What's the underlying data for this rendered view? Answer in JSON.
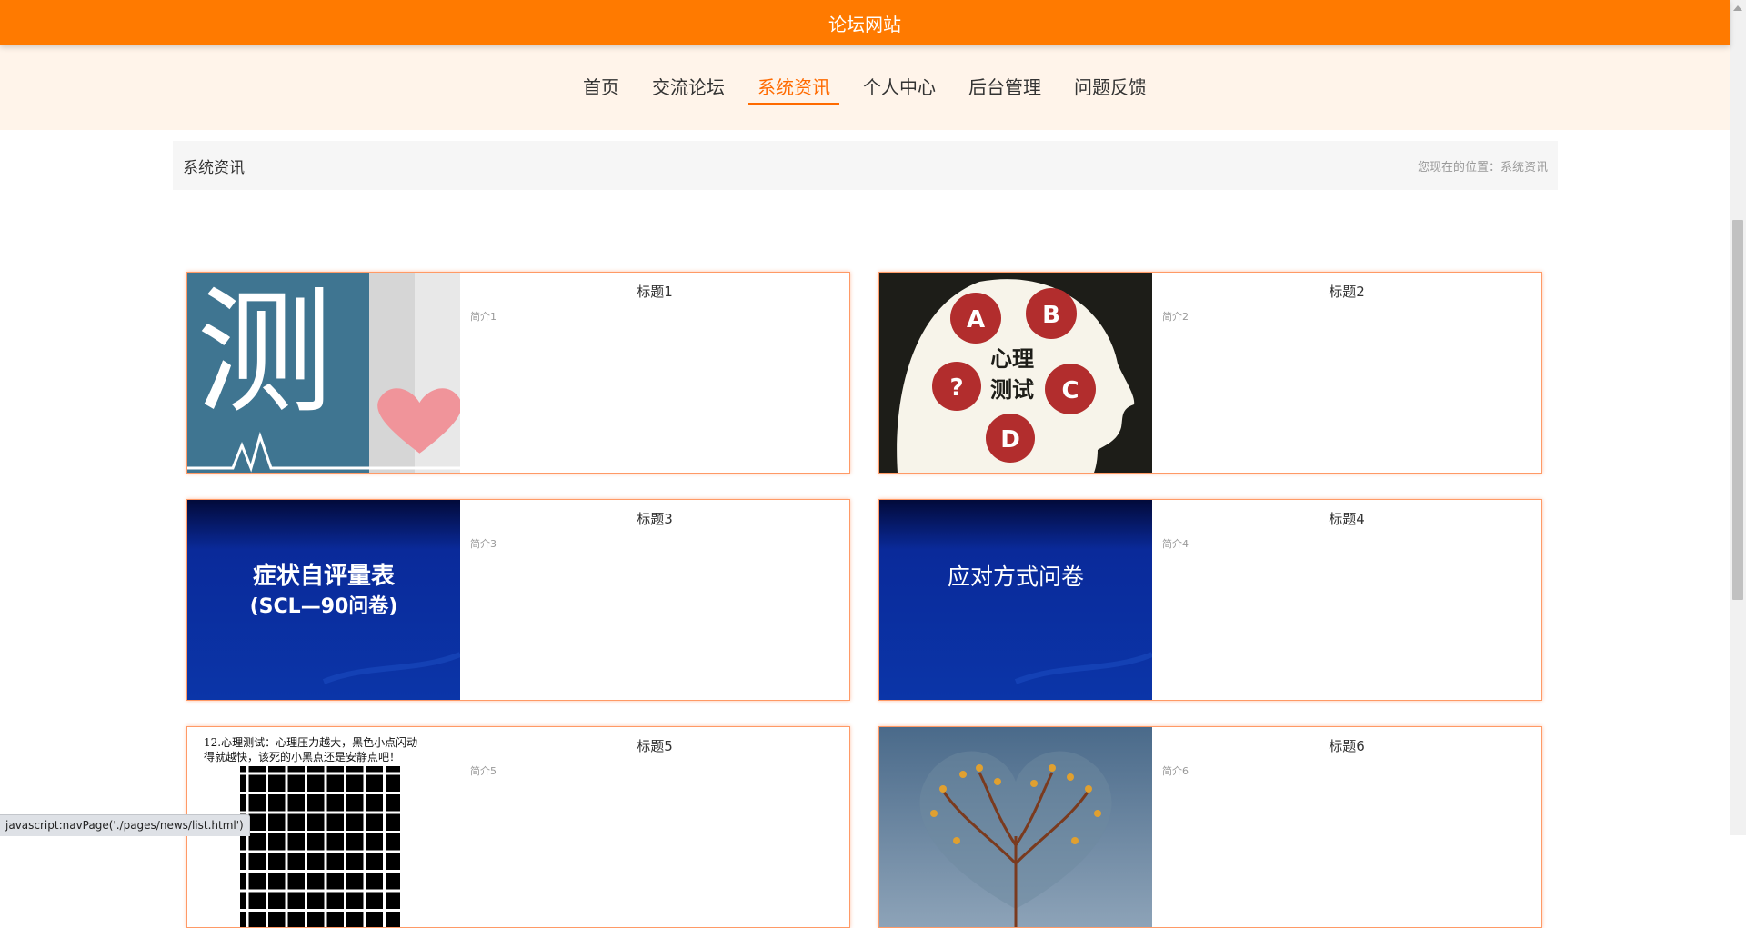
{
  "header": {
    "title": "论坛网站"
  },
  "nav": {
    "items": [
      {
        "label": "首页"
      },
      {
        "label": "交流论坛"
      },
      {
        "label": "系统资讯"
      },
      {
        "label": "个人中心"
      },
      {
        "label": "后台管理"
      },
      {
        "label": "问题反馈"
      }
    ],
    "active_index": 2
  },
  "breadcrumb": {
    "title": "系统资讯",
    "location_label": "您现在的位置：",
    "location_value": "系统资讯"
  },
  "cards": [
    {
      "title": "标题1",
      "intro": "简介1",
      "image": "heart-test-image",
      "image_text": "测"
    },
    {
      "title": "标题2",
      "intro": "简介2",
      "image": "head-profile-image",
      "image_text": [
        "心理",
        "测试"
      ],
      "bubbles": [
        "A",
        "B",
        "?",
        "C",
        "D"
      ]
    },
    {
      "title": "标题3",
      "intro": "简介3",
      "image": "blue-banner-image",
      "image_text": [
        "症状自评量表",
        "(SCL—90问卷)"
      ]
    },
    {
      "title": "标题4",
      "intro": "简介4",
      "image": "blue-banner-image",
      "image_text": [
        "应对方式问卷"
      ]
    },
    {
      "title": "标题5",
      "intro": "简介5",
      "image": "grid-illusion-image",
      "image_text": [
        "12.心理测试：心理压力越大，黑色小点闪动",
        "得就越快，该死的小黑点还是安静点吧！"
      ]
    },
    {
      "title": "标题6",
      "intro": "简介6",
      "image": "tree-heart-image"
    }
  ],
  "status_bar": {
    "text": "javascript:navPage('./pages/news/list.html')"
  },
  "colors": {
    "accent": "#ff7a00",
    "active_nav": "#ff6a00",
    "nav_bg": "#fff4ea",
    "card_border": "#ff9a66"
  }
}
